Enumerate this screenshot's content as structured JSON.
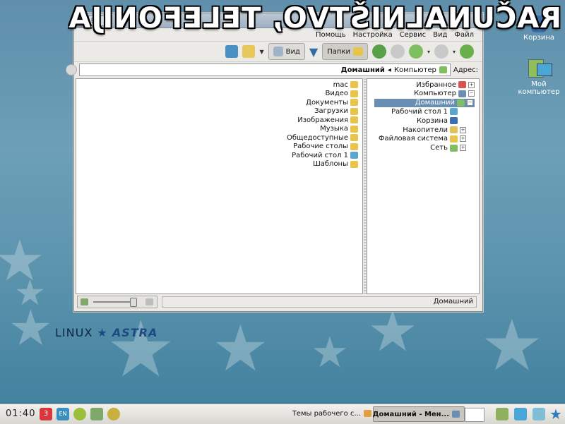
{
  "watermark": "RAČUNALNIŠTVO, TELEFONIJA",
  "desktop": {
    "icons": [
      {
        "label": "Корзина"
      },
      {
        "label": "Мой компьютер"
      }
    ],
    "logo": {
      "astra": "ASTRA",
      "linux": "LINUX"
    }
  },
  "window": {
    "title": "Домашний",
    "menu": [
      "Файл",
      "Вид",
      "Сервис",
      "Настройка",
      "Помощь"
    ],
    "toolbar": {
      "folders_label": "Папки",
      "view_label": "Вид"
    },
    "address": {
      "label": "Адрес:",
      "path": [
        "Компьютер",
        "Домашний"
      ]
    },
    "files": [
      {
        "name": "mac",
        "color": "#e9c44c"
      },
      {
        "name": "Видео",
        "color": "#e9c44c"
      },
      {
        "name": "Документы",
        "color": "#e9c44c"
      },
      {
        "name": "Загрузки",
        "color": "#e9c44c"
      },
      {
        "name": "Изображения",
        "color": "#e9c44c"
      },
      {
        "name": "Музыка",
        "color": "#e9c44c"
      },
      {
        "name": "Общедоступные",
        "color": "#e9c44c"
      },
      {
        "name": "Рабочие столы",
        "color": "#e9c44c"
      },
      {
        "name": "Рабочий стол 1",
        "color": "#5ba6d1"
      },
      {
        "name": "Шаблоны",
        "color": "#e9c44c"
      }
    ],
    "tree": [
      {
        "label": "Избранное",
        "icon_color": "#d9534f",
        "pm": "+",
        "selected": false
      },
      {
        "label": "Компьютер",
        "icon_color": "#6c8fb0",
        "pm": "−",
        "selected": false
      },
      {
        "label": "Домашний",
        "icon_color": "#7fbf5f",
        "pm": "−",
        "selected": true
      },
      {
        "label": "Рабочий стол 1",
        "icon_color": "#5ba6d1",
        "pm": "",
        "selected": false
      },
      {
        "label": "Корзина",
        "icon_color": "#3c6fb0",
        "pm": "",
        "selected": false
      },
      {
        "label": "Накопители",
        "icon_color": "#e0c15a",
        "pm": "+",
        "selected": false
      },
      {
        "label": "Файловая система",
        "icon_color": "#e9c44c",
        "pm": "+",
        "selected": false
      },
      {
        "label": "Сеть",
        "icon_color": "#7fbf5f",
        "pm": "+",
        "selected": false
      }
    ],
    "status": "Домашний",
    "zoom_fraction": 0.9
  },
  "taskbar": {
    "clock": "01:40",
    "tasks": [
      {
        "label": "Темы рабочего с...",
        "active": false
      },
      {
        "label": "Домашний - Мен...",
        "active": true
      }
    ]
  },
  "colors": {
    "selection": "#6a8db2",
    "folder": "#e9c44c",
    "desktop": "#5f8fab"
  }
}
